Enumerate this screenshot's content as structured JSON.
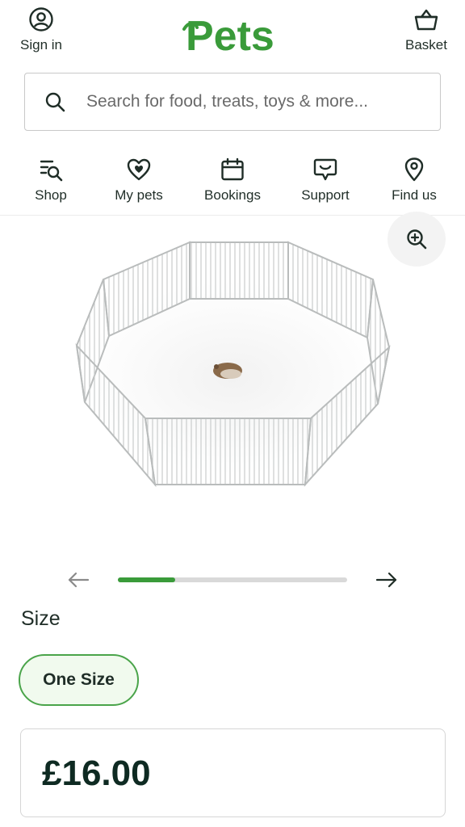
{
  "header": {
    "sign_in_label": "Sign in",
    "logo_text": "Pets",
    "basket_label": "Basket"
  },
  "search": {
    "placeholder": "Search for food, treats, toys & more..."
  },
  "nav": {
    "items": [
      {
        "label": "Shop",
        "icon": "shop-search-icon"
      },
      {
        "label": "My pets",
        "icon": "heart-paw-icon"
      },
      {
        "label": "Bookings",
        "icon": "calendar-icon"
      },
      {
        "label": "Support",
        "icon": "chat-bubble-icon"
      },
      {
        "label": "Find us",
        "icon": "location-pin-icon"
      }
    ]
  },
  "gallery": {
    "image": "octagonal wire playpen with hamster",
    "zoom_icon": "zoom-in-icon",
    "progress": 0.25
  },
  "product": {
    "size_title": "Size",
    "size_option": "One Size",
    "price": "£16.00"
  },
  "colors": {
    "brand_green": "#3a9b3a",
    "chip_bg": "#f1faee",
    "text_dark": "#0e2a22"
  }
}
